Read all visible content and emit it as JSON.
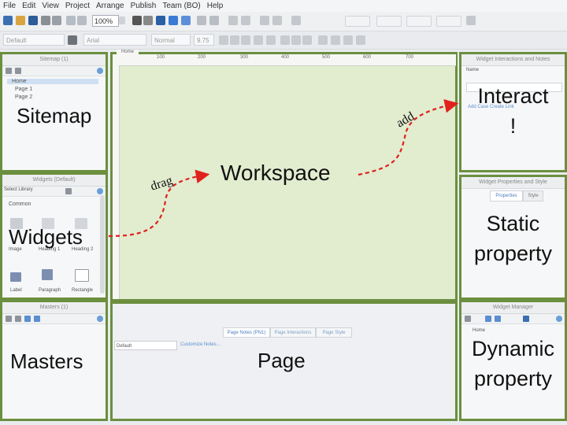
{
  "menu": [
    "File",
    "Edit",
    "View",
    "Project",
    "Arrange",
    "Publish",
    "Team (BO)",
    "Help"
  ],
  "toolbar": {
    "zoom": "100%"
  },
  "format_bar": {
    "style": "Default",
    "font": "Arial",
    "weight": "Normal",
    "size": "9.75"
  },
  "panels": {
    "sitemap": {
      "header": "Sitemap (1)",
      "pages": [
        "Home",
        "Page 1",
        "Page 2"
      ],
      "label": "Sitemap"
    },
    "widgets": {
      "header": "Widgets (Default)",
      "search": "Select Library",
      "group": "Common",
      "items": [
        "Image",
        "Heading 1",
        "Heading 2",
        "Label",
        "Paragraph",
        "Rectangle"
      ],
      "label": "Widgets"
    },
    "masters": {
      "header": "Masters (1)",
      "label": "Masters"
    },
    "interact": {
      "header": "Widget Interactions and Notes",
      "name_label": "Name",
      "link1": "Add Case",
      "link2": "Create Link",
      "label": "Interact\n!"
    },
    "static": {
      "header": "Widget Properties and Style",
      "tab1": "Properties",
      "tab2": "Style",
      "label": "Static\nproperty"
    },
    "dynamic": {
      "header": "Widget Manager",
      "page": "Home",
      "label": "Dynamic\nproperty"
    }
  },
  "workspace": {
    "tab": "Home",
    "ruler": [
      "100",
      "200",
      "300",
      "400",
      "500",
      "600",
      "700"
    ],
    "label": "Workspace"
  },
  "page_panel": {
    "tabs": [
      "Page Notes (PN1)",
      "Page Interactions",
      "Page Style"
    ],
    "select": "Default",
    "link": "Customize Notes...",
    "label": "Page"
  },
  "annotations": {
    "drag": "drag",
    "add": "add"
  },
  "colors": {
    "panel_border": "#6b8f3e",
    "workspace_bg": "#e2eccf",
    "arrow": "#e0211c"
  }
}
